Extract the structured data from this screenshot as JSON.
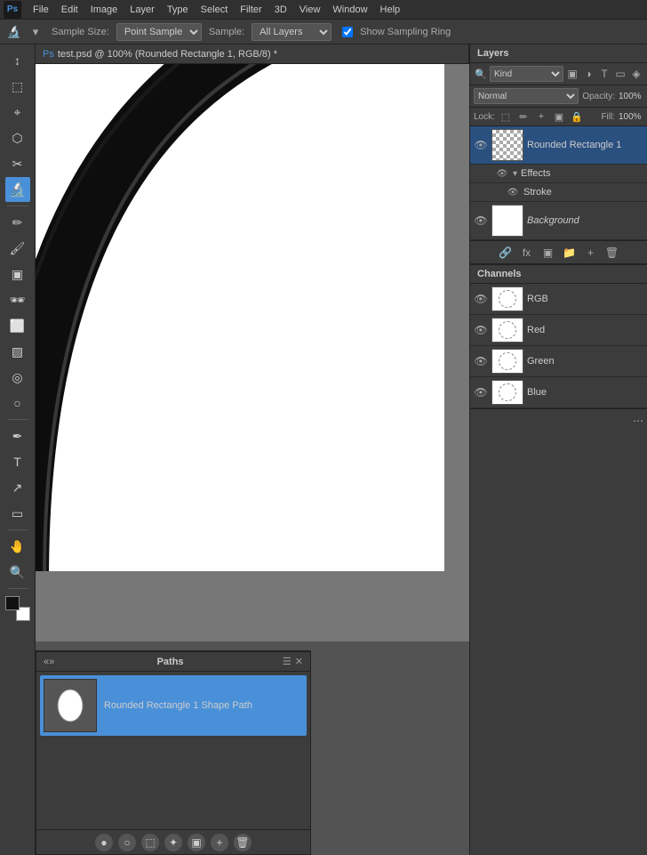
{
  "menubar": {
    "items": [
      "Ps",
      "File",
      "Edit",
      "Image",
      "Layer",
      "Type",
      "Select",
      "Filter",
      "3D",
      "View",
      "Window",
      "Help"
    ]
  },
  "toolbar": {
    "sample_size_label": "Sample Size:",
    "sample_size_value": "Point Sample",
    "sample_label": "Sample:",
    "sample_value": "All Layers",
    "show_sampling_ring_label": "Show Sampling Ring",
    "eyedropper_icon": "🔬"
  },
  "canvas": {
    "tab_title": "test.psd @ 100% (Rounded Rectangle 1, RGB/8) *"
  },
  "paths_panel": {
    "title": "Paths",
    "items": [
      {
        "name": "Rounded Rectangle 1 Shape Path"
      }
    ]
  },
  "layers_panel": {
    "title": "Layers",
    "filter_label": "Kind",
    "blend_mode": "Normal",
    "opacity_label": "Opacity:",
    "opacity_value": "100%",
    "lock_label": "Lock:",
    "fill_label": "Fill:",
    "fill_value": "100%",
    "layers": [
      {
        "name": "Rounded Rectangle 1",
        "has_effects": true,
        "effects": [
          "Stroke"
        ]
      },
      {
        "name": "Background",
        "is_italic": true
      }
    ]
  },
  "channels_panel": {
    "title": "Channels",
    "channels": [
      {
        "name": "RGB"
      },
      {
        "name": "Red"
      },
      {
        "name": "Green"
      },
      {
        "name": "Blue"
      }
    ]
  },
  "tools": [
    {
      "icon": "↕",
      "name": "move-tool"
    },
    {
      "icon": "⬚",
      "name": "marquee-tool"
    },
    {
      "icon": "⌖",
      "name": "lasso-tool"
    },
    {
      "icon": "⬡",
      "name": "magic-wand-tool"
    },
    {
      "icon": "✂",
      "name": "crop-tool"
    },
    {
      "icon": "✒",
      "name": "eyedropper-tool"
    },
    {
      "icon": "✏",
      "name": "healing-tool"
    },
    {
      "icon": "🖌",
      "name": "brush-tool"
    },
    {
      "icon": "▣",
      "name": "clone-tool"
    },
    {
      "icon": "🕶",
      "name": "history-brush-tool"
    },
    {
      "icon": "⬜",
      "name": "eraser-tool"
    },
    {
      "icon": "▨",
      "name": "gradient-tool"
    },
    {
      "icon": "🔍",
      "name": "dodge-tool"
    },
    {
      "icon": "✒",
      "name": "pen-tool"
    },
    {
      "icon": "T",
      "name": "type-tool"
    },
    {
      "icon": "↗",
      "name": "path-selection-tool"
    },
    {
      "icon": "▭",
      "name": "shape-tool"
    },
    {
      "icon": "🤚",
      "name": "hand-tool"
    },
    {
      "icon": "🔍",
      "name": "zoom-tool"
    }
  ]
}
